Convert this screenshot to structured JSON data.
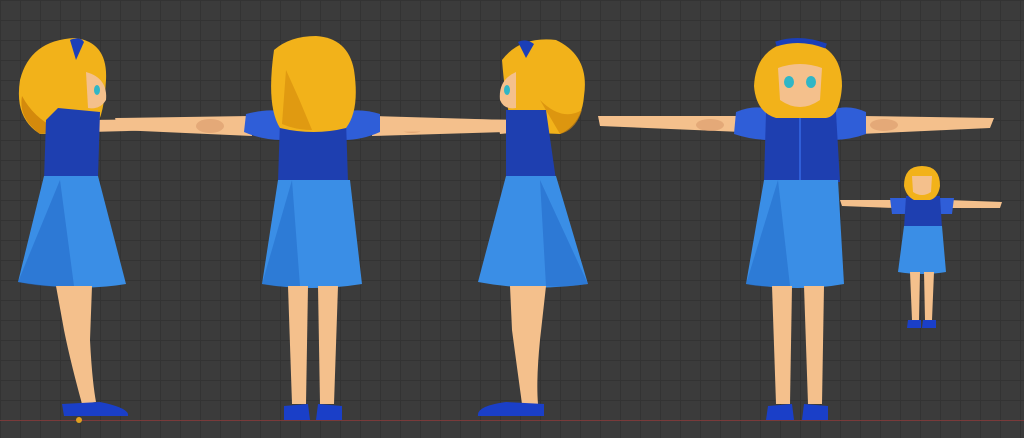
{
  "viewport": {
    "background": "#3b3b3b",
    "grid_color": "#333333",
    "floor_line_color": "#7a3a3a",
    "origin_color": "#e0a020"
  },
  "model": {
    "hair_color": "#f2b21a",
    "hair_shadow": "#d48a0c",
    "skin_color": "#f4c08c",
    "skin_shadow": "#d99a6a",
    "top_color": "#1e3fb0",
    "top_highlight": "#2f5ed8",
    "skirt_color": "#3a8ee6",
    "skirt_shadow": "#1f63c4",
    "shoe_color": "#1a3fc8",
    "headband_color": "#1b3fb8",
    "eye_color": "#2fb6c6"
  },
  "views": [
    "side-left",
    "back",
    "side-right",
    "front",
    "front-small"
  ]
}
